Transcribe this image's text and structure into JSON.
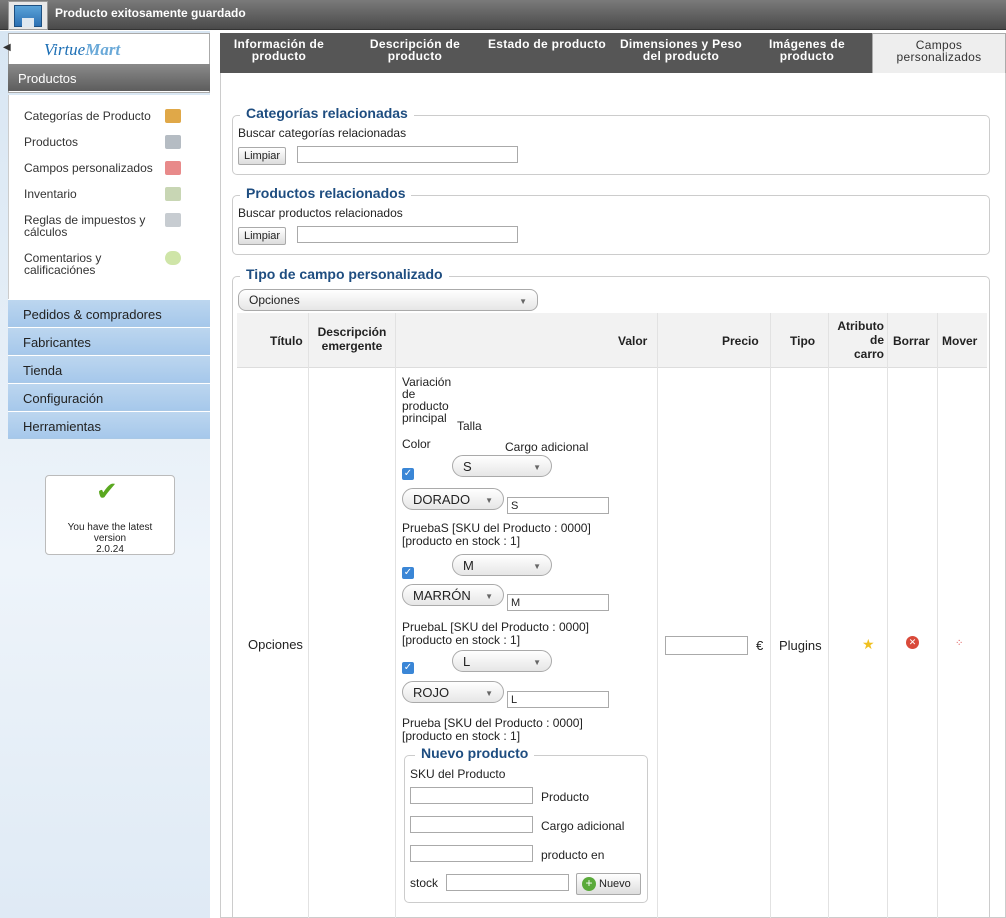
{
  "topbar": {
    "message": "Producto exitosamente guardado"
  },
  "sidebar": {
    "logo_main": "Virtue",
    "logo_accent": "Mart",
    "section": "Productos",
    "items": [
      {
        "label": "Categorías de Producto",
        "icon": "folder-icon",
        "color": "#e0a848"
      },
      {
        "label": "Productos",
        "icon": "camera-icon",
        "color": "#9aa4ad"
      },
      {
        "label": "Campos personalizados",
        "icon": "fields-icon",
        "color": "#e05a5a"
      },
      {
        "label": "Inventario",
        "icon": "chart-icon",
        "color": "#8ca46a"
      },
      {
        "label": "Reglas de impuestos y",
        "label2": "cálculos",
        "icon": "calculator-icon",
        "color": "#9aa4ad"
      },
      {
        "label": "Comentarios y",
        "label2": "calificaciónes",
        "icon": "comment-icon",
        "color": "#9ec86a"
      }
    ],
    "menu": [
      "Pedidos & compradores",
      "Fabricantes",
      "Tienda",
      "Configuración",
      "Herramientas"
    ],
    "version": {
      "line1": "You have the latest",
      "line2": "version",
      "line3": "2.0.24"
    }
  },
  "tabs": [
    {
      "l1": "Información de",
      "l2": "producto"
    },
    {
      "l1": "Descripción de",
      "l2": "producto"
    },
    {
      "l1": "Estado de producto",
      "l2": ""
    },
    {
      "l1": "Dimensiones y Peso",
      "l2": "del producto"
    },
    {
      "l1": "Imágenes de",
      "l2": "producto"
    },
    {
      "l1": "Campos",
      "l2": "personalizados"
    }
  ],
  "cat": {
    "legend": "Categorías relacionadas",
    "label": "Buscar categorías relacionadas",
    "clear": "Limpiar"
  },
  "prod": {
    "legend": "Productos relacionados",
    "label": "Buscar productos relacionados",
    "clear": "Limpiar"
  },
  "custom": {
    "legend": "Tipo de campo personalizado",
    "select": "Opciones",
    "headers": {
      "titulo": "Título",
      "desc1": "Descripción",
      "desc2": "emergente",
      "valor": "Valor",
      "precio": "Precio",
      "tipo": "Tipo",
      "attr1": "Atributo",
      "attr2": "de",
      "attr3": "carro",
      "borrar": "Borrar",
      "mover": "Mover"
    },
    "row": {
      "titulo": "Opciones",
      "currency": "€",
      "tipo": "Plugins"
    },
    "variation": {
      "l1": "Variación",
      "l2": "de",
      "l3": "producto",
      "l4": "principal",
      "talla": "Talla",
      "color": "Color",
      "cargo": "Cargo adicional"
    },
    "variants": [
      {
        "size": "S",
        "color": "DORADO",
        "input": "S",
        "desc1": "PruebaS [SKU del Producto : 0000]",
        "desc2": "[producto en stock : 1]"
      },
      {
        "size": "M",
        "color": "MARRÓN",
        "input": "M",
        "desc1": "PruebaL [SKU del Producto : 0000]",
        "desc2": "[producto en stock : 1]"
      },
      {
        "size": "L",
        "color": "ROJO",
        "input": "L",
        "desc1": "Prueba [SKU del Producto : 0000]",
        "desc2": "[producto en stock : 1]"
      }
    ],
    "newproduct": {
      "legend": "Nuevo producto",
      "sku": "SKU del Producto",
      "producto": "Producto",
      "cargo": "Cargo adicional",
      "stock1": "producto en",
      "stock2": "stock",
      "button": "Nuevo"
    }
  }
}
